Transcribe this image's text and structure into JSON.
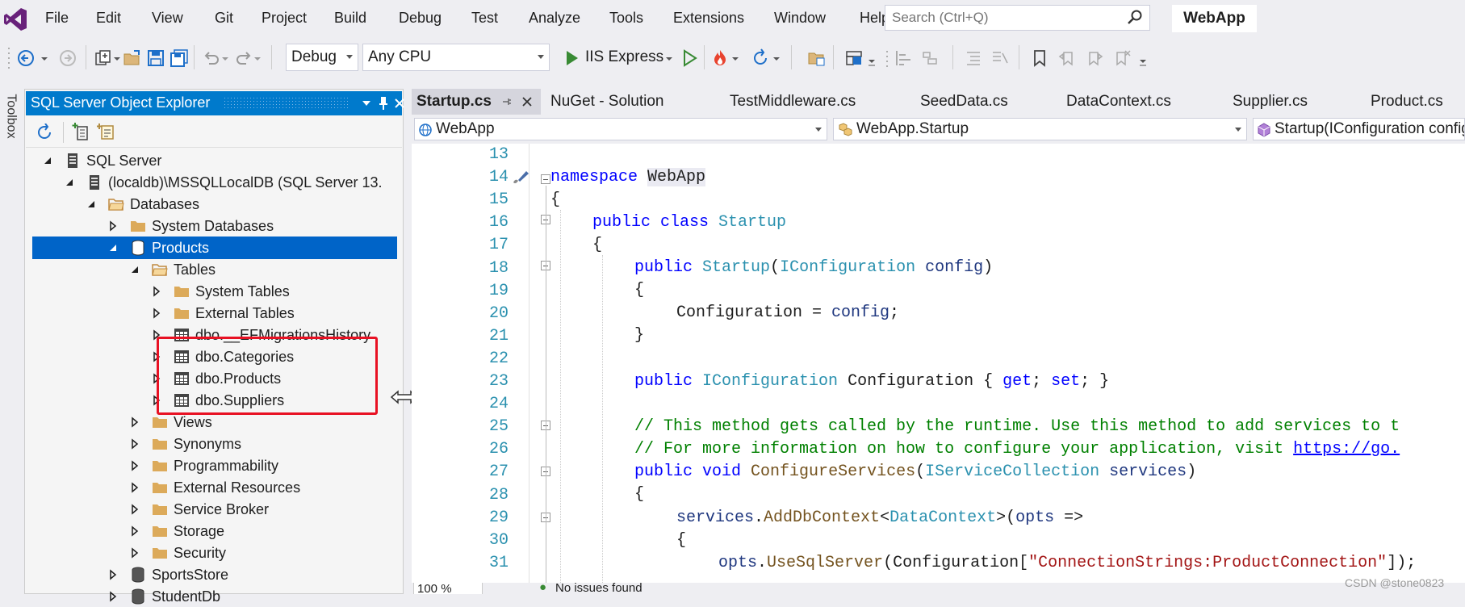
{
  "menubar": {
    "items": [
      "File",
      "Edit",
      "View",
      "Git",
      "Project",
      "Build",
      "Debug",
      "Test",
      "Analyze",
      "Tools",
      "Extensions",
      "Window",
      "Help"
    ],
    "search_placeholder": "Search (Ctrl+Q)",
    "solution_name": "WebApp"
  },
  "toolbar": {
    "config": "Debug",
    "platform": "Any CPU",
    "run_label": "IIS Express"
  },
  "toolbox_label": "Toolbox",
  "explorer": {
    "title": "SQL Server Object Explorer",
    "tree": [
      {
        "label": "SQL Server",
        "expanded": true
      },
      {
        "label": "(localdb)\\MSSQLLocalDB (SQL Server 13.",
        "expanded": true
      },
      {
        "label": "Databases",
        "expanded": true
      },
      {
        "label": "System Databases",
        "expanded": false
      },
      {
        "label": "Products",
        "expanded": true,
        "selected": true
      },
      {
        "label": "Tables",
        "expanded": true
      },
      {
        "label": "System Tables",
        "expanded": false
      },
      {
        "label": "External Tables",
        "expanded": false
      },
      {
        "label": "dbo.__EFMigrationsHistory",
        "expanded": false
      },
      {
        "label": "dbo.Categories",
        "expanded": false
      },
      {
        "label": "dbo.Products",
        "expanded": false
      },
      {
        "label": "dbo.Suppliers",
        "expanded": false
      },
      {
        "label": "Views",
        "expanded": false
      },
      {
        "label": "Synonyms",
        "expanded": false
      },
      {
        "label": "Programmability",
        "expanded": false
      },
      {
        "label": "External Resources",
        "expanded": false
      },
      {
        "label": "Service Broker",
        "expanded": false
      },
      {
        "label": "Storage",
        "expanded": false
      },
      {
        "label": "Security",
        "expanded": false
      },
      {
        "label": "SportsStore",
        "expanded": false
      },
      {
        "label": "StudentDb",
        "expanded": false
      }
    ]
  },
  "editor": {
    "tabs": [
      "Startup.cs",
      "NuGet - Solution",
      "TestMiddleware.cs",
      "SeedData.cs",
      "DataContext.cs",
      "Supplier.cs",
      "Product.cs"
    ],
    "nav": {
      "project": "WebApp",
      "type": "WebApp.Startup",
      "member": "Startup(IConfiguration config)"
    },
    "line_numbers": [
      "13",
      "14",
      "15",
      "16",
      "17",
      "18",
      "19",
      "20",
      "21",
      "22",
      "23",
      "24",
      "25",
      "26",
      "27",
      "28",
      "29",
      "30",
      "31"
    ],
    "lines": {
      "l14_kw": "namespace",
      "l14_name": "WebApp",
      "l15": "{",
      "l16_kw": "public class",
      "l16_name": "Startup",
      "l17": "{",
      "l18_kw": "public",
      "l18_name": "Startup",
      "l18_type": "IConfiguration",
      "l18_param": "config",
      "l19": "{",
      "l20_a": "Configuration = ",
      "l20_b": "config",
      "l21": "}",
      "l23_kw": "public",
      "l23_type": "IConfiguration",
      "l23_name": "Configuration { ",
      "l23_get": "get",
      "l23_set": "set",
      "l25": "// This method gets called by the runtime. Use this method to add services to t",
      "l26": "// For more information on how to configure your application, visit ",
      "l26_link": "https://go.",
      "l27_kw": "public void",
      "l27_name": "ConfigureServices",
      "l27_type": "IServiceCollection",
      "l27_param": "services",
      "l28": "{",
      "l29_a": "services",
      "l29_b": "AddDbContext",
      "l29_type": "DataContext",
      "l29_param": "opts",
      "l30": "{",
      "l31_a": "opts",
      "l31_b": "UseSqlServer",
      "l31_c": "Configuration[",
      "l31_str": "\"ConnectionStrings:ProductConnection\"",
      "l31_d": "]);"
    }
  },
  "status": {
    "zoom": "100 %",
    "issues": "No issues found"
  },
  "watermark": "CSDN @stone0823"
}
